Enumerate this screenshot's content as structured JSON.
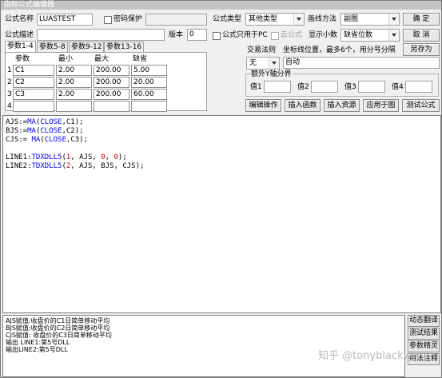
{
  "window": {
    "title": "指标公式编辑器"
  },
  "formula": {
    "name_label": "公式名称",
    "name_value": "LUASTEST",
    "password_label": "密码保护",
    "desc_label": "公式描述",
    "desc_value": "",
    "version_label": "版本",
    "version_value": "0",
    "type_label": "公式类型",
    "type_value": "其他类型",
    "draw_label": "画线方法",
    "draw_value": "副图",
    "pc_only_label": "公式只用于PC",
    "cloud_label": "云公式",
    "decimals_label": "显示小数",
    "decimals_value": "缺省位数"
  },
  "buttons": {
    "ok": "确  定",
    "cancel": "取  消",
    "save_as": "另存为",
    "edit_ops": "编辑操作",
    "insert_func": "插入函数",
    "insert_res": "插入资源",
    "apply_chart": "应用于图",
    "test_formula": "测试公式",
    "dyn_translate": "动态翻译",
    "test_result": "测试结果",
    "param_wizard": "参数精灵",
    "usage_note": "用法注释"
  },
  "tabs": [
    "参数1-4",
    "参数5-8",
    "参数9-12",
    "参数13-16"
  ],
  "params": {
    "headers": [
      "参数",
      "最小",
      "最大",
      "缺省"
    ],
    "rows": [
      {
        "n": "1",
        "name": "C1",
        "min": "2.00",
        "max": "200.00",
        "def": "5.00"
      },
      {
        "n": "2",
        "name": "C2",
        "min": "2.00",
        "max": "200.00",
        "def": "20.00"
      },
      {
        "n": "3",
        "name": "C3",
        "min": "2.00",
        "max": "200.00",
        "def": "60.00"
      },
      {
        "n": "4",
        "name": "",
        "min": "",
        "max": "",
        "def": ""
      }
    ]
  },
  "trade": {
    "rule_label": "交易法则",
    "rule_value": "无",
    "coord_label": "坐标线位置，最多6个，用分号分隔",
    "coord_value": "自动",
    "extra_y_label": "额外Y轴分界",
    "values": [
      "值1",
      "值2",
      "值3",
      "值4"
    ]
  },
  "code": {
    "l1": {
      "a": "AJS:=",
      "fn": "MA",
      "b": "(",
      "kw": "CLOSE",
      "c": ",C1);"
    },
    "l2": {
      "a": "BJS:=",
      "fn": "MA",
      "b": "(",
      "kw": "CLOSE",
      "c": ",C2);"
    },
    "l3": {
      "a": "CJS:= ",
      "fn": "MA",
      "b": "(",
      "kw": "CLOSE",
      "c": ",C3);"
    },
    "l5": {
      "a": "LINE1:",
      "fn": "TDXDLL5",
      "b": "(",
      "n1": "1",
      "c": ", AJS, ",
      "n2": "0",
      "d": ", ",
      "n3": "0",
      "e": ");"
    },
    "l6": {
      "a": "LINE2:",
      "fn": "TDXDLL5",
      "b": "(",
      "n1": "2",
      "c": ", AJS, BJS, CJS);"
    }
  },
  "output": [
    "AJS赋值:收盘价的C1日简单移动平均",
    "BJS赋值:收盘价的C2日简单移动平均",
    "CJS赋值: 收盘价的C3日简单移动平均",
    "输出 LINE1:第5号DLL",
    "输出LINE2:第5号DLL"
  ],
  "watermark": "知乎 @tonyblackwh"
}
